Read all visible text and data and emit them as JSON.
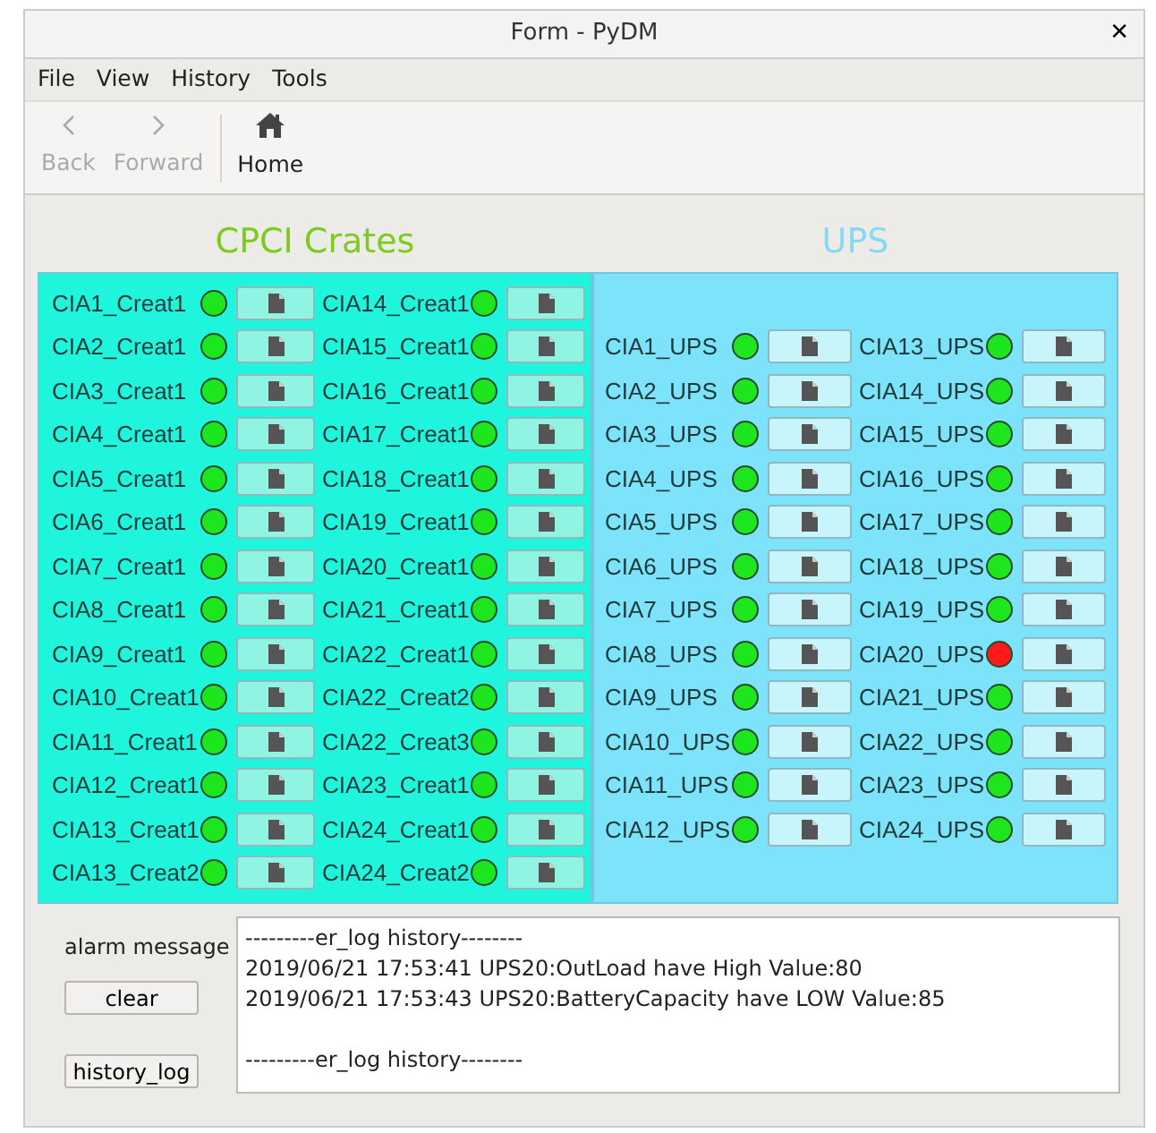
{
  "window": {
    "title": "Form - PyDM",
    "close": "✕"
  },
  "menu": [
    "File",
    "View",
    "History",
    "Tools"
  ],
  "toolbar": [
    {
      "label": "Back",
      "kind": "back",
      "disabled": true
    },
    {
      "label": "Forward",
      "kind": "forward",
      "disabled": true
    },
    {
      "label": "Home",
      "kind": "home",
      "disabled": false
    }
  ],
  "panels": [
    {
      "title": "CPCI Crates",
      "kind": "crates",
      "columns": [
        [
          {
            "name": "CIA1_Creat1",
            "alarm": false
          },
          {
            "name": "CIA2_Creat1",
            "alarm": false
          },
          {
            "name": "CIA3_Creat1",
            "alarm": false
          },
          {
            "name": "CIA4_Creat1",
            "alarm": false
          },
          {
            "name": "CIA5_Creat1",
            "alarm": false
          },
          {
            "name": "CIA6_Creat1",
            "alarm": false
          },
          {
            "name": "CIA7_Creat1",
            "alarm": false
          },
          {
            "name": "CIA8_Creat1",
            "alarm": false
          },
          {
            "name": "CIA9_Creat1",
            "alarm": false
          },
          {
            "name": "CIA10_Creat1",
            "alarm": false
          },
          {
            "name": "CIA11_Creat1",
            "alarm": false
          },
          {
            "name": "CIA12_Creat1",
            "alarm": false
          },
          {
            "name": "CIA13_Creat1",
            "alarm": false
          },
          {
            "name": "CIA13_Creat2",
            "alarm": false
          }
        ],
        [
          {
            "name": "CIA14_Creat1",
            "alarm": false
          },
          {
            "name": "CIA15_Creat1",
            "alarm": false
          },
          {
            "name": "CIA16_Creat1",
            "alarm": false
          },
          {
            "name": "CIA17_Creat1",
            "alarm": false
          },
          {
            "name": "CIA18_Creat1",
            "alarm": false
          },
          {
            "name": "CIA19_Creat1",
            "alarm": false
          },
          {
            "name": "CIA20_Creat1",
            "alarm": false
          },
          {
            "name": "CIA21_Creat1",
            "alarm": false
          },
          {
            "name": "CIA22_Creat1",
            "alarm": false
          },
          {
            "name": "CIA22_Creat2",
            "alarm": false
          },
          {
            "name": "CIA22_Creat3",
            "alarm": false
          },
          {
            "name": "CIA23_Creat1",
            "alarm": false
          },
          {
            "name": "CIA24_Creat1",
            "alarm": false
          },
          {
            "name": "CIA24_Creat2",
            "alarm": false
          }
        ]
      ]
    },
    {
      "title": "UPS",
      "kind": "ups",
      "columns": [
        [
          {
            "name": "CIA1_UPS",
            "alarm": false
          },
          {
            "name": "CIA2_UPS",
            "alarm": false
          },
          {
            "name": "CIA3_UPS",
            "alarm": false
          },
          {
            "name": "CIA4_UPS",
            "alarm": false
          },
          {
            "name": "CIA5_UPS",
            "alarm": false
          },
          {
            "name": "CIA6_UPS",
            "alarm": false
          },
          {
            "name": "CIA7_UPS",
            "alarm": false
          },
          {
            "name": "CIA8_UPS",
            "alarm": false
          },
          {
            "name": "CIA9_UPS",
            "alarm": false
          },
          {
            "name": "CIA10_UPS",
            "alarm": false
          },
          {
            "name": "CIA11_UPS",
            "alarm": false
          },
          {
            "name": "CIA12_UPS",
            "alarm": false
          }
        ],
        [
          {
            "name": "CIA13_UPS",
            "alarm": false
          },
          {
            "name": "CIA14_UPS",
            "alarm": false
          },
          {
            "name": "CIA15_UPS",
            "alarm": false
          },
          {
            "name": "CIA16_UPS",
            "alarm": false
          },
          {
            "name": "CIA17_UPS",
            "alarm": false
          },
          {
            "name": "CIA18_UPS",
            "alarm": false
          },
          {
            "name": "CIA19_UPS",
            "alarm": false
          },
          {
            "name": "CIA20_UPS",
            "alarm": true
          },
          {
            "name": "CIA21_UPS",
            "alarm": false
          },
          {
            "name": "CIA22_UPS",
            "alarm": false
          },
          {
            "name": "CIA23_UPS",
            "alarm": false
          },
          {
            "name": "CIA24_UPS",
            "alarm": false
          }
        ]
      ]
    }
  ],
  "alarm_label": "alarm message",
  "buttons": [
    "clear",
    "history_log"
  ],
  "log": {
    "lines": [
      "---------er_log history--------",
      "2019/06/21 17:53:41 UPS20:OutLoad have High Value:80",
      "2019/06/21 17:53:43 UPS20:BatteryCapacity have LOW Value:85"
    ],
    "footer": "---------er_log history--------"
  }
}
